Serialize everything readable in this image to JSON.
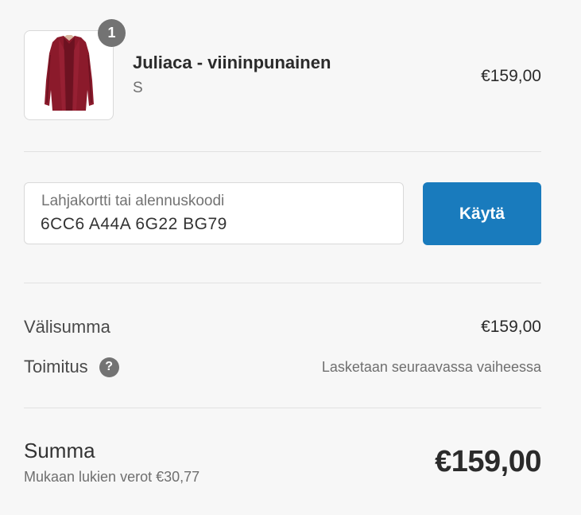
{
  "product": {
    "quantity": "1",
    "name": "Juliaca - viininpunainen",
    "variant": "S",
    "price": "€159,00",
    "image": "burgundy-cardigan-image"
  },
  "discount": {
    "label": "Lahjakortti tai alennuskoodi",
    "value": "6CC6 A44A 6G22 BG79",
    "apply_label": "Käytä"
  },
  "totals": {
    "subtotal_label": "Välisumma",
    "subtotal_value": "€159,00",
    "shipping_label": "Toimitus",
    "shipping_help_icon": "question-mark-icon",
    "shipping_value": "Lasketaan seuraavassa vaiheessa"
  },
  "grand_total": {
    "label": "Summa",
    "tax_note": "Mukaan lukien verot €30,77",
    "value": "€159,00"
  },
  "colors": {
    "page_background": "#f7f7f7",
    "apply_button": "#197bbd",
    "badge": "#737373",
    "divider": "#e1e1e1",
    "product_color": "#8b1a2b"
  }
}
